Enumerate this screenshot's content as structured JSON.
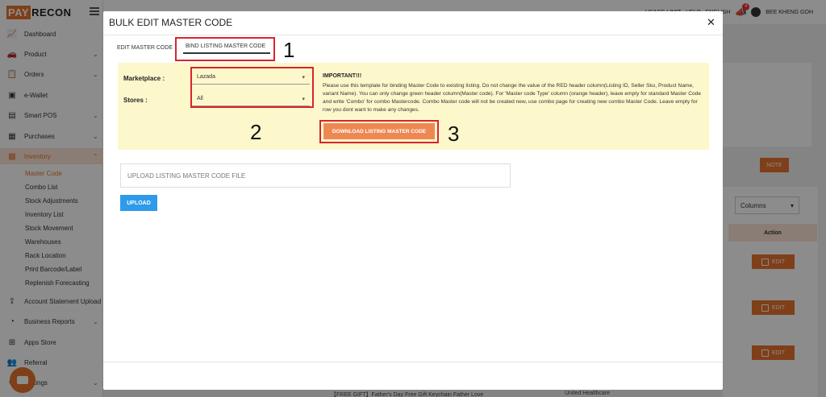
{
  "brand": {
    "part1": "PAY",
    "part2": "RECON"
  },
  "topbar": {
    "item1": "USAGE LIMIT",
    "item2": "HELP",
    "item3": "ENGLISH",
    "notification_count": "4",
    "user": "BEE KHENG GOH"
  },
  "sidebar": {
    "items": [
      {
        "label": "Dashboard",
        "icon": "chart-line-icon"
      },
      {
        "label": "Product",
        "icon": "car-icon"
      },
      {
        "label": "Orders",
        "icon": "clipboard-icon"
      },
      {
        "label": "e-Wallet",
        "icon": "wallet-icon"
      },
      {
        "label": "Smart POS",
        "icon": "phone-icon"
      },
      {
        "label": "Purchases",
        "icon": "warehouse-icon"
      },
      {
        "label": "Inventory",
        "icon": "boxes-icon"
      },
      {
        "label": "Account Statement Upload",
        "icon": "upload-icon"
      },
      {
        "label": "Business Reports",
        "icon": "pie-chart-icon"
      },
      {
        "label": "Apps Store",
        "icon": "grid-icon"
      },
      {
        "label": "Referral",
        "icon": "people-icon"
      },
      {
        "label": "Settings",
        "icon": "gear-icon"
      }
    ],
    "inventory_sub": [
      "Master Code",
      "Combo List",
      "Stock Adjustments",
      "Inventory List",
      "Stock Movement",
      "Warehouses",
      "Rack Location",
      "Print Barcode/Label",
      "Replenish Forecasting"
    ]
  },
  "background": {
    "note_label": "NOTE",
    "columns_label": "Columns",
    "action_header": "Action",
    "edit_label": "EDIT",
    "bottom_text": "【FREE GIFT】Father's Day Free Gift Keychain Father Love",
    "bottom_brand": "United Healthcare"
  },
  "modal": {
    "title": "BULK EDIT MASTER CODE",
    "tabs": [
      {
        "label": "EDIT MASTER CODE"
      },
      {
        "label": "BIND LISTING MASTER CODE"
      }
    ],
    "marketplace_label": "Marketplace :",
    "marketplace_value": "Lazada",
    "stores_label": "Stores :",
    "stores_value": "All",
    "important_title": "IMPORTANT!!!",
    "important_text": "Please use this template for binding Master Code to existing listing. Do not change the value of the RED header column(Listing ID, Seller Sku, Product Name, variant Name). You can only change green header column(Master code). For 'Master code Type' column (orange header), leave empty for standard Master Code and write 'Combo' for combo Mastercode. Combo Master code will not be created new, use combo page for creating new combo Master Code. Leave empty for row you dont want to make any changes.",
    "download_label": "DOWNLOAD LISTING MASTER CODE",
    "upload_placeholder": "UPLOAD LISTING MASTER CODE FILE",
    "upload_button": "UPLOAD"
  },
  "annotations": [
    "1",
    "2",
    "3"
  ]
}
